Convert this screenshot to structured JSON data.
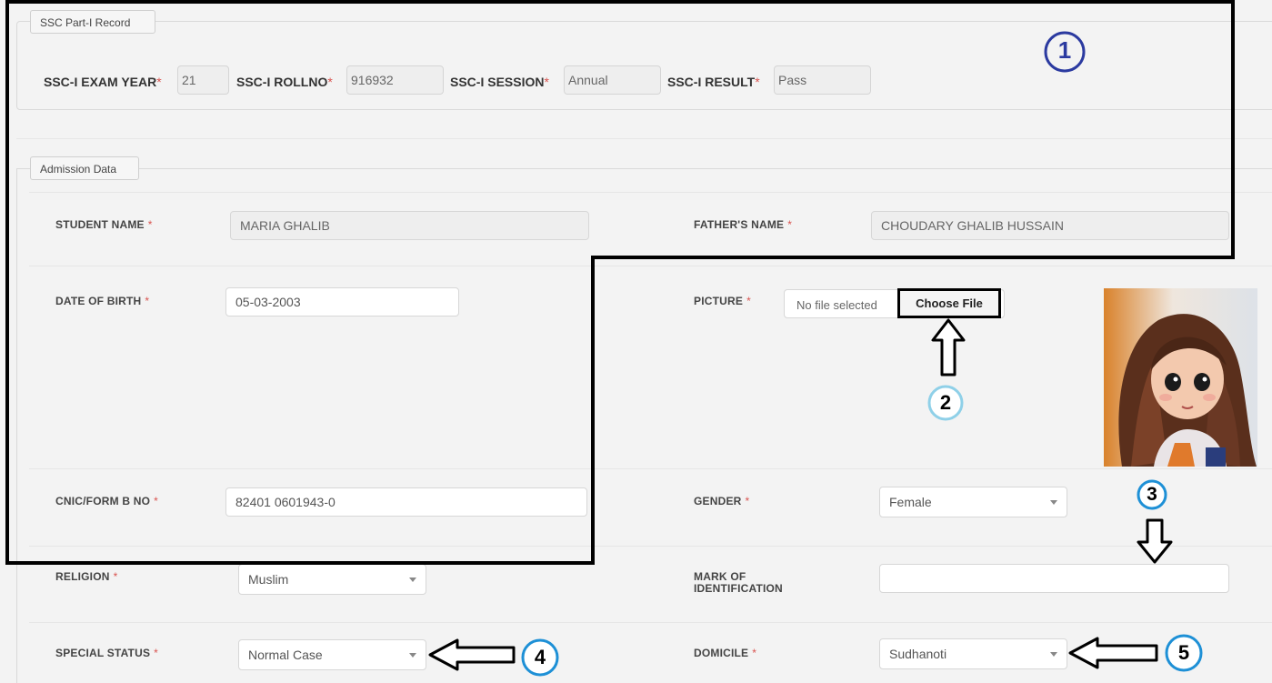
{
  "ssc_section": {
    "legend": "SSC Part-I Record",
    "exam_year": {
      "label": "SSC-I EXAM YEAR",
      "value": "21"
    },
    "rollno": {
      "label": "SSC-I ROLLNO",
      "value": "916932"
    },
    "session": {
      "label": "SSC-I SESSION",
      "value": "Annual"
    },
    "result": {
      "label": "SSC-I RESULT",
      "value": "Pass"
    }
  },
  "admission_section": {
    "legend": "Admission Data",
    "student_name": {
      "label": "STUDENT NAME",
      "value": "MARIA GHALIB"
    },
    "father_name": {
      "label": "FATHER'S NAME",
      "value": "CHOUDARY GHALIB HUSSAIN"
    },
    "dob": {
      "label": "DATE OF BIRTH",
      "value": "05-03-2003"
    },
    "picture": {
      "label": "PICTURE",
      "file_status": "No file selected",
      "button": "Choose File"
    },
    "cnic": {
      "label": "CNIC/FORM B NO",
      "value": "82401 0601943-0"
    },
    "gender": {
      "label": "GENDER",
      "value": "Female"
    },
    "religion": {
      "label": "RELIGION",
      "value": "Muslim"
    },
    "mark_of_identification": {
      "label_line1": "MARK OF",
      "label_line2": "IDENTIFICATION",
      "value": ""
    },
    "special_status": {
      "label": "SPECIAL STATUS",
      "value": "Normal Case"
    },
    "domicile": {
      "label": "DOMICILE",
      "value": "Sudhanoti"
    }
  },
  "required_marker": "*",
  "annotations": [
    "1",
    "2",
    "3",
    "4",
    "5"
  ],
  "colors": {
    "required": "#d9534f",
    "annotation_circle_1": "#2b3aa0",
    "annotation_circle_2": "#8fd0e8",
    "annotation_circle_3_5": "#1e90d6",
    "highlight_border": "#000000"
  }
}
